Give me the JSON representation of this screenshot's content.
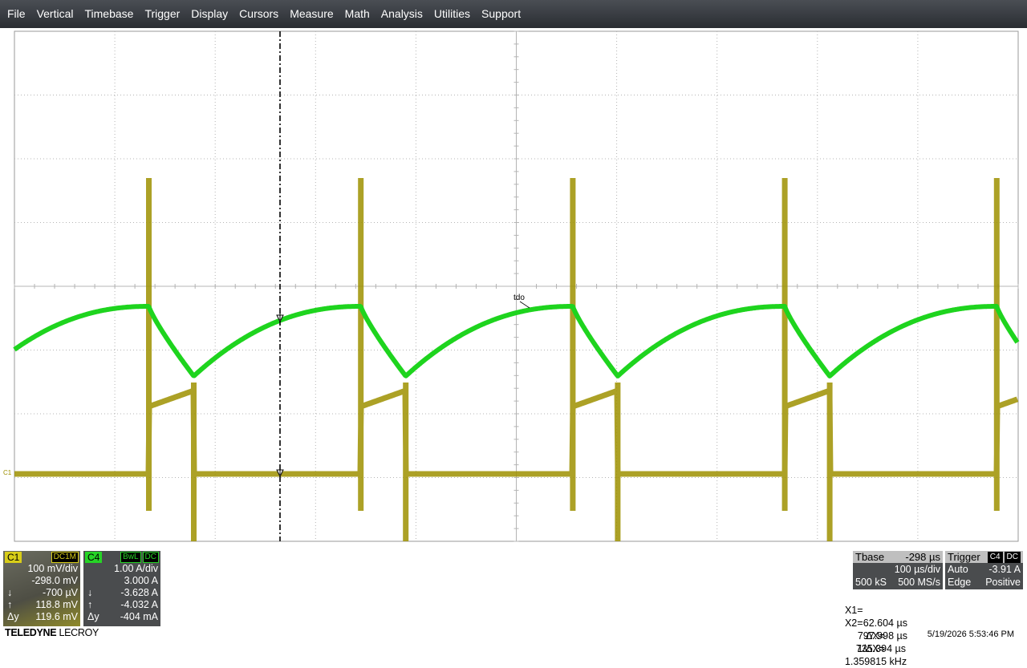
{
  "menu": [
    "File",
    "Vertical",
    "Timebase",
    "Trigger",
    "Display",
    "Cursors",
    "Measure",
    "Math",
    "Analysis",
    "Utilities",
    "Support"
  ],
  "trace": {
    "label": "tdo",
    "ground_label": "C1"
  },
  "colors": {
    "c1": "#d8cd18",
    "c4": "#26d426",
    "c1_trace": "#9e9000",
    "c4_trace": "#1ed41e"
  },
  "c1": {
    "tag": "C1",
    "coupling": "DC1M",
    "vdiv": "100 mV/div",
    "offset": "-298.0 mV",
    "down_sym": "↓",
    "down": "-700 µV",
    "up_sym": "↑",
    "up": "118.8 mV",
    "dy_sym": "Δy",
    "dy": "119.6 mV"
  },
  "c4": {
    "tag": "C4",
    "bwl": "BwL",
    "coupling": "DC",
    "adiv": "1.00 A/div",
    "offset": "3.000 A",
    "down_sym": "↓",
    "down": "-3.628 A",
    "up_sym": "↑",
    "up": "-4.032 A",
    "dy_sym": "Δy",
    "dy": "-404 mA"
  },
  "timebase": {
    "label": "Tbase",
    "delay": "-298 µs",
    "tdiv": "100 µs/div",
    "samples": "500 kS",
    "rate": "500 MS/s"
  },
  "trigger": {
    "label": "Trigger",
    "src": "C4",
    "coupling": "DC",
    "mode": "Auto",
    "level": "-3.91 A",
    "type": "Edge",
    "slope": "Positive"
  },
  "cursors": {
    "x1_label": "X1=",
    "x1": "62.604 µs",
    "dx_label": "ΔX=",
    "dx": "735.394 µs",
    "x2_label": "X2=",
    "x2": "797.998 µs",
    "inv_label": "1/ΔX=",
    "inv": "1.359815 kHz"
  },
  "logo": {
    "brand": "TELEDYNE",
    "product": "LECROY"
  },
  "timestamp": "5/19/2026 5:53:46 PM"
}
